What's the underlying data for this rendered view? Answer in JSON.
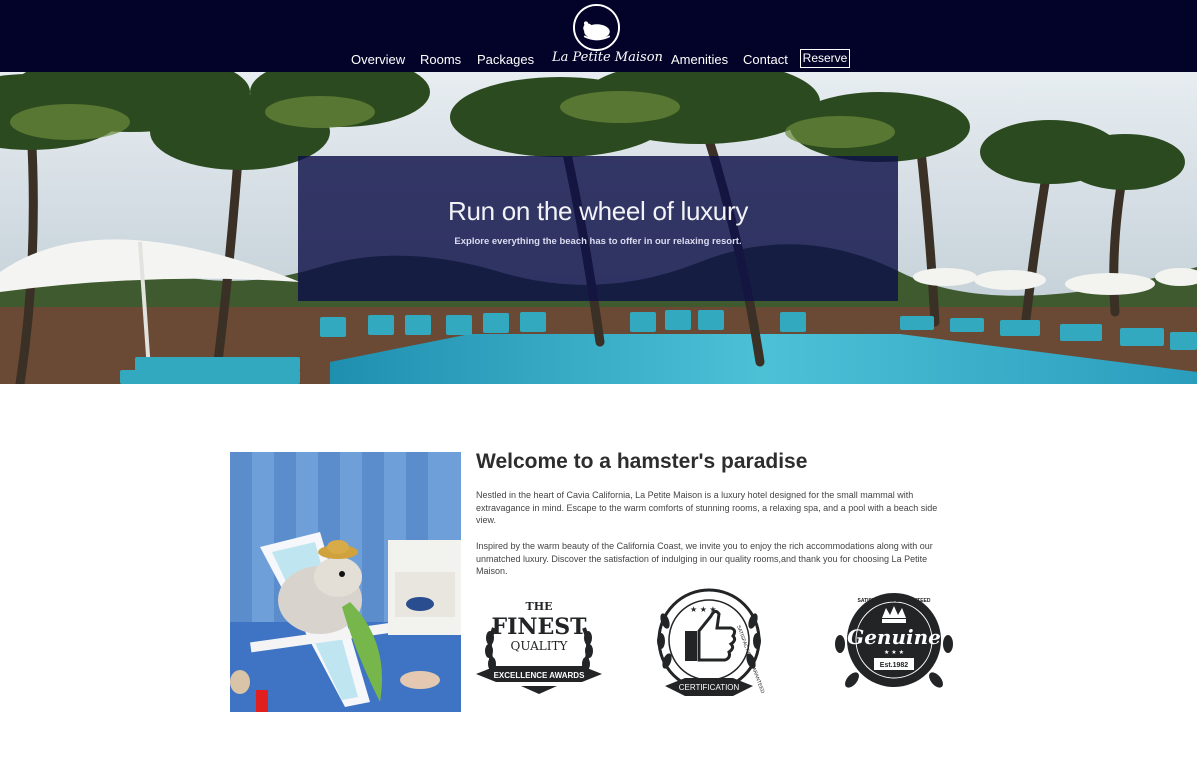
{
  "header": {
    "logo_icon": "hamster-logo-icon",
    "nav": {
      "overview": "Overview",
      "rooms": "Rooms",
      "packages": "Packages",
      "brand": "La Petite Maison",
      "amenities": "Amenities",
      "contact": "Contact",
      "reserve": "Reserve"
    }
  },
  "hero": {
    "title": "Run on the wheel of luxury",
    "subtitle": "Explore everything the beach has to offer in our relaxing resort."
  },
  "welcome": {
    "title": "Welcome to a hamster's paradise",
    "paragraph_1": "Nestled in the heart of Cavia California, La Petite Maison is a luxury hotel designed for the small mammal with extravagance in mind. Escape to the warm comforts of stunning rooms, a relaxing spa, and a pool with a beach side view.",
    "paragraph_2": "Inspired by the warm beauty of the California Coast, we invite you to enjoy the rich accommodations along with our unmatched luxury. Discover the satisfaction of indulging in our quality rooms,and thank you for choosing La Petite Maison."
  },
  "badges": {
    "finest": {
      "top": "THE",
      "main": "FINEST",
      "sub": "QUALITY",
      "ribbon": "EXCELLENCE AWARDS"
    },
    "certification": {
      "arc": "SATISFACTION GUARANTEED",
      "ribbon": "CERTIFICATION"
    },
    "genuine": {
      "arc": "SATISFACTION GUARANTEED",
      "main": "Genuine",
      "ribbon": "Est.1982"
    }
  },
  "colors": {
    "header_bg": "#03032a",
    "hero_overlay": "#0e1048",
    "badge_dark": "#222426"
  }
}
